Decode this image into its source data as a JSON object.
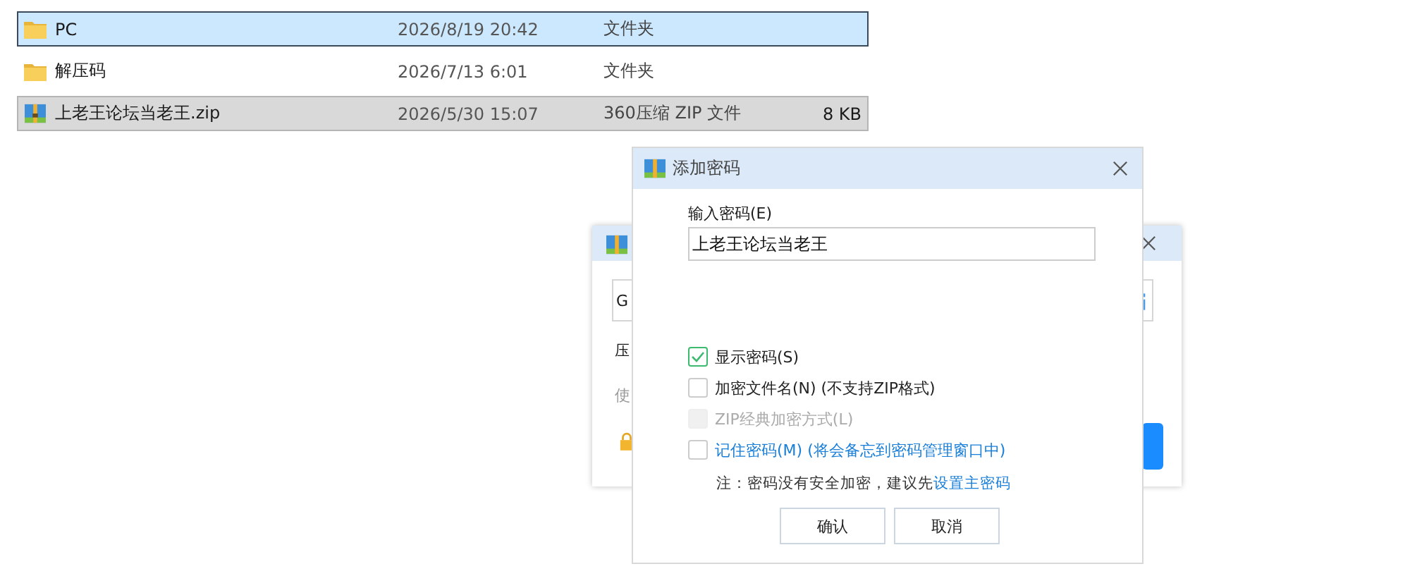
{
  "files": [
    {
      "name": "PC",
      "kind": "folder",
      "date": "2026/8/19 20:42",
      "type": "文件夹",
      "selected": true,
      "hovered": false
    },
    {
      "name": "解压码",
      "kind": "folder",
      "date": "2026/7/13 6:01",
      "type": "文件夹",
      "selected": false,
      "hovered": false
    },
    {
      "name": "上老王论坛当老王.zip",
      "kind": "archive",
      "date": "2026/5/30 15:07",
      "type": "360压缩 ZIP 文件",
      "size": "8 KB",
      "selected": false,
      "hovered": true
    }
  ],
  "back_dialog": {
    "field_value": "G",
    "label": "压",
    "hint": "使"
  },
  "dialog": {
    "title": "添加密码",
    "password_label": "输入密码(E)",
    "password_value": "上老王论坛当老王",
    "options": [
      {
        "label": "显示密码(S)",
        "checked": true,
        "disabled": false,
        "link": false
      },
      {
        "label": "加密文件名(N) (不支持ZIP格式)",
        "checked": false,
        "disabled": false,
        "link": false
      },
      {
        "label": "ZIP经典加密方式(L)",
        "checked": false,
        "disabled": true,
        "link": false
      },
      {
        "label": "记住密码(M) (将会备忘到密码管理窗口中)",
        "checked": false,
        "disabled": false,
        "link": true
      }
    ],
    "note": "注：密码没有安全加密，建议先",
    "note_link": "设置主密码",
    "buttons": [
      "确认",
      "取消"
    ]
  }
}
